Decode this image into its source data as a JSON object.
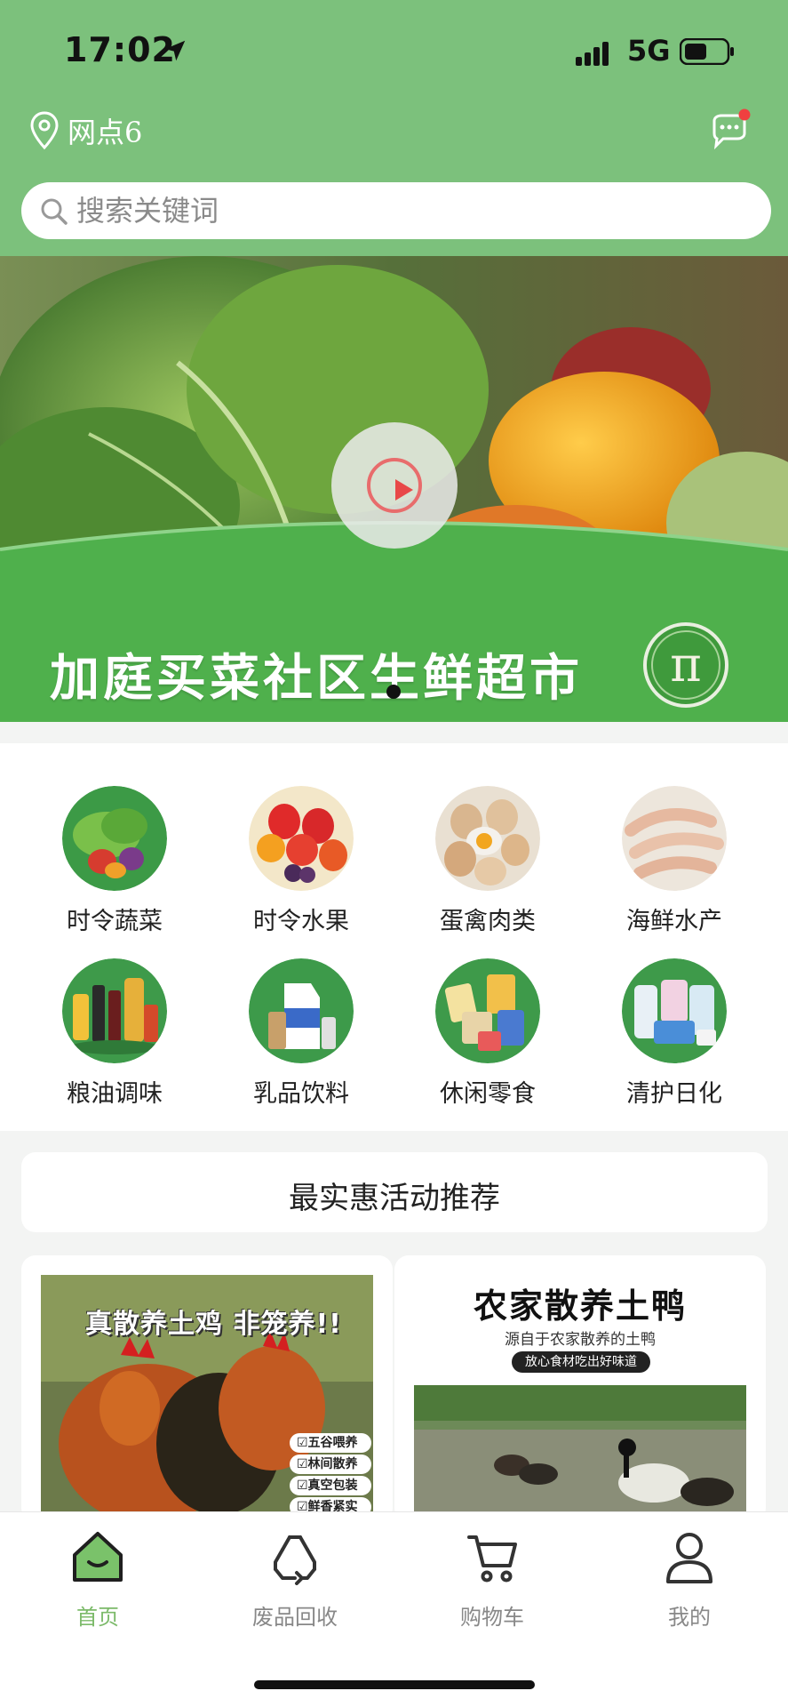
{
  "status_bar": {
    "time": "17:02",
    "network": "5G"
  },
  "header": {
    "location_label": "网点6",
    "search_placeholder": "搜索关键词"
  },
  "banner": {
    "title": "加庭买菜社区生鲜超市",
    "logo_glyph": "π"
  },
  "categories": [
    {
      "label": "时令蔬菜",
      "icon": "vegetables-icon"
    },
    {
      "label": "时令水果",
      "icon": "fruits-icon"
    },
    {
      "label": "蛋禽肉类",
      "icon": "eggs-meat-icon"
    },
    {
      "label": "海鲜水产",
      "icon": "seafood-icon"
    },
    {
      "label": "粮油调味",
      "icon": "oil-seasoning-icon"
    },
    {
      "label": "乳品饮料",
      "icon": "dairy-drinks-icon"
    },
    {
      "label": "休闲零食",
      "icon": "snacks-icon"
    },
    {
      "label": "清护日化",
      "icon": "cleaning-care-icon"
    }
  ],
  "promo": {
    "section_title": "最实惠活动推荐",
    "chicken_card": {
      "headline": "真散养土鸡 非笼养!!",
      "tags": [
        "☑五谷喂养",
        "☑林间散养",
        "☑真空包装",
        "☑鲜香紧实"
      ]
    },
    "duck_card": {
      "title": "农家散养土鸭",
      "subtitle": "源自于农家散养的土鸭",
      "pill": "放心食材吃出好味道"
    }
  },
  "bottom_nav": [
    {
      "label": "首页",
      "icon": "home-icon",
      "active": true
    },
    {
      "label": "废品回收",
      "icon": "recycle-icon",
      "active": false
    },
    {
      "label": "购物车",
      "icon": "cart-icon",
      "active": false
    },
    {
      "label": "我的",
      "icon": "profile-icon",
      "active": false
    }
  ],
  "colors": {
    "brand_green": "#7cc17c",
    "nav_active": "#7cba6a",
    "notification_dot": "#f04040"
  }
}
